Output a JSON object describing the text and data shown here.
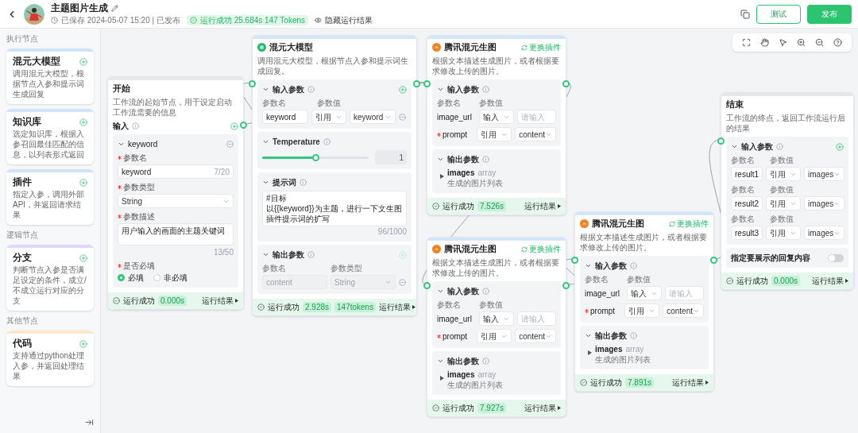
{
  "header": {
    "title": "主题图片生成",
    "saved": "已保存 2024-05-07 15:20 | 已发布",
    "run_status": "运行成功 25.684s 147 Tokens",
    "hide_results": "隐藏运行结果",
    "buttons": [
      {
        "label": "测试",
        "kind": "outline"
      },
      {
        "label": "发布",
        "kind": "primary"
      }
    ]
  },
  "sidebar": {
    "groups": [
      {
        "title": "执行节点",
        "items": [
          {
            "title": "混元大模型",
            "description": "调用混元大模型，根据节点入参和提示词生成回复",
            "color": "#cfe3fb"
          },
          {
            "title": "知识库",
            "description": "选定知识库，根据入参召回最佳匹配的信息，以列表形式返回",
            "color": "#cfe3fb"
          },
          {
            "title": "插件",
            "description": "指定入参，调用外部API，并返回请求结果",
            "color": "#cfe3fb"
          }
        ]
      },
      {
        "title": "逻辑节点",
        "items": [
          {
            "title": "分支",
            "description": "判断节点入参是否满足设定的条件，成立/不成立运行对应的分支",
            "color": "#e0d7fb"
          }
        ]
      },
      {
        "title": "其他节点",
        "items": [
          {
            "title": "代码",
            "description": "支持通过python处理入参，并返回处理结果",
            "color": "#fde7c6"
          }
        ]
      }
    ]
  },
  "nodes": [
    {
      "kind": "start",
      "title": "开始",
      "description": "工作流的起始节点，用于设定启动工作流需要的信息",
      "sections": [
        {
          "kind": "label",
          "title": "输入",
          "addable": true
        },
        {
          "kind": "param",
          "name": "keyword",
          "fields": [
            {
              "kind": "input",
              "label": "参数名",
              "required": true,
              "value": "keyword",
              "count": "7/20"
            },
            {
              "kind": "select",
              "label": "参数类型",
              "required": true,
              "value": "String"
            },
            {
              "kind": "textarea",
              "label": "参数描述",
              "required": true,
              "value": "用户输入的画面的主题关键词",
              "count": "13/50"
            },
            {
              "kind": "radio",
              "label": "是否必填",
              "required": true,
              "options": [
                {
                  "label": "必填",
                  "selected": true
                },
                {
                  "label": "非必填",
                  "selected": false
                }
              ]
            }
          ]
        }
      ],
      "footer": {
        "status": "运行成功",
        "badges": [
          "0.000s"
        ],
        "result": "运行结果"
      }
    },
    {
      "kind": "llm",
      "title": "混元大模型",
      "description": "调用混元大模型，根据节点入参和提示词生成回复。",
      "sections": [
        {
          "kind": "inputs",
          "title": "输入参数",
          "addable": true,
          "editable_names": true,
          "col_name": "参数名",
          "col_value": "参数值",
          "rows": [
            {
              "name": "keyword",
              "source": "引用",
              "value": "keyword",
              "removable": true
            }
          ]
        },
        {
          "kind": "slider",
          "title": "Temperature",
          "level": 0.5,
          "value": "1"
        },
        {
          "kind": "prompt",
          "title": "提示词",
          "lines": [
            "#目标",
            "以{{keyword}}为主题，进行一下文生图插件提示词的扩写"
          ],
          "count": "96/1000"
        },
        {
          "kind": "outputs",
          "title": "输出参数",
          "col_name": "参数名",
          "col_type": "参数类型",
          "rows": [
            {
              "name": "content",
              "type": "String"
            }
          ]
        }
      ],
      "footer": {
        "status": "运行成功",
        "badges": [
          "2.928s",
          "147tokens"
        ],
        "result": "运行结果"
      }
    },
    {
      "kind": "plugin",
      "title": "腾讯混元生图",
      "action": "更换插件",
      "description": "根据文本描述生成图片，或者根据要求修改上传的图片。",
      "sections": [
        {
          "kind": "inputs",
          "title": "输入参数",
          "addable": false,
          "editable_names": false,
          "col_name": "参数名",
          "col_value": "参数值",
          "rows": [
            {
              "name": "image_url",
              "required": false,
              "source": "输入",
              "placeholder": "请输入",
              "removable": false
            },
            {
              "name": "prompt",
              "required": true,
              "source": "引用",
              "value": "content",
              "removable": false
            }
          ]
        },
        {
          "kind": "output_tree",
          "title": "输出参数",
          "name": "images",
          "type": "array",
          "description": "生成的图片列表"
        }
      ],
      "footer": {
        "status": "运行成功",
        "badges": [
          "7.526s"
        ],
        "result": "运行结果"
      }
    },
    {
      "kind": "plugin",
      "title": "腾讯混元生图",
      "action": "更换插件",
      "description": "根据文本描述生成图片，或者根据要求修改上传的图片。",
      "sections": [
        {
          "kind": "inputs",
          "title": "输入参数",
          "addable": false,
          "editable_names": false,
          "col_name": "参数名",
          "col_value": "参数值",
          "rows": [
            {
              "name": "image_url",
              "required": false,
              "source": "输入",
              "placeholder": "请输入",
              "removable": false
            },
            {
              "name": "prompt",
              "required": true,
              "source": "引用",
              "value": "content",
              "removable": false
            }
          ]
        },
        {
          "kind": "output_tree",
          "title": "输出参数",
          "name": "images",
          "type": "array",
          "description": "生成的图片列表"
        }
      ],
      "footer": {
        "status": "运行成功",
        "badges": [
          "7.927s"
        ],
        "result": "运行结果"
      }
    },
    {
      "kind": "plugin",
      "title": "腾讯混元生图",
      "action": "更换插件",
      "description": "根据文本描述生成图片，或者根据要求修改上传的图片。",
      "sections": [
        {
          "kind": "inputs",
          "title": "输入参数",
          "addable": false,
          "editable_names": false,
          "col_name": "参数名",
          "col_value": "参数值",
          "rows": [
            {
              "name": "image_url",
              "required": false,
              "source": "输入",
              "placeholder": "请输入",
              "removable": false
            },
            {
              "name": "prompt",
              "required": true,
              "source": "引用",
              "value": "content",
              "removable": false
            }
          ]
        },
        {
          "kind": "output_tree",
          "title": "输出参数",
          "name": "images",
          "type": "array",
          "description": "生成的图片列表"
        }
      ],
      "footer": {
        "status": "运行成功",
        "badges": [
          "7.891s"
        ],
        "result": "运行结果"
      }
    },
    {
      "kind": "end",
      "title": "结束",
      "description": "工作流的终点，返回工作流运行后的结果",
      "sections": [
        {
          "kind": "inputs",
          "title": "输入参数",
          "addable": true,
          "editable_names": true,
          "rows": [
            {
              "name_label": "参数名",
              "value_label": "参数值",
              "name": "result1",
              "source": "引用",
              "value": "images",
              "removable": false
            },
            {
              "name_label": "参数名",
              "value_label": "参数值",
              "name": "result2",
              "source": "引用",
              "value": "images",
              "removable": false
            },
            {
              "name_label": "参数名",
              "value_label": "参数值",
              "name": "result3",
              "source": "引用",
              "value": "images",
              "removable": false
            }
          ]
        },
        {
          "kind": "toggle",
          "label": "指定要展示的回复内容",
          "on": false
        }
      ],
      "footer": {
        "status": "运行成功",
        "badges": [
          "0.000s"
        ],
        "result": "运行结果"
      }
    }
  ]
}
